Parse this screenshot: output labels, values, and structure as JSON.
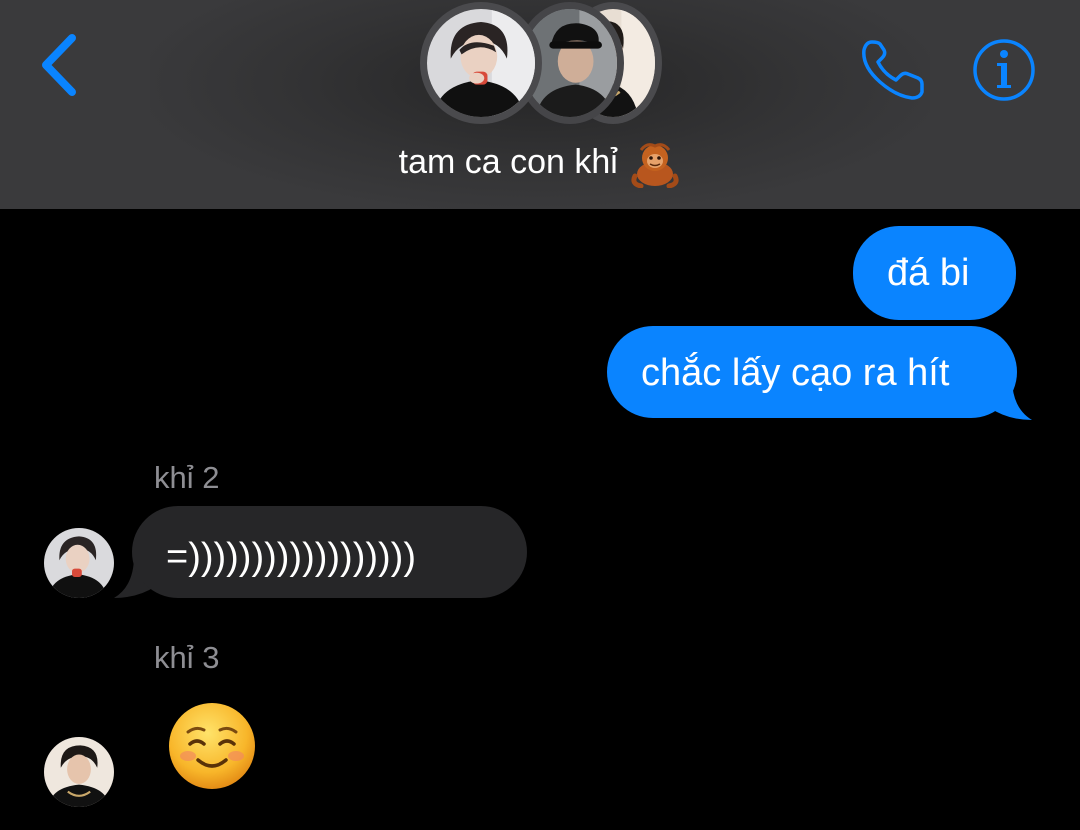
{
  "header": {
    "back_icon": "chevron-left-icon",
    "call_icon": "phone-icon",
    "info_icon": "info-circle-icon",
    "group_title": "tam ca con khỉ",
    "title_emoji": "orangutan-emoji",
    "accent_color": "#0a84ff"
  },
  "messages": {
    "outgoing": [
      {
        "text": "đá bi"
      },
      {
        "text": "chắc lấy cạo ra hít"
      }
    ],
    "incoming": [
      {
        "sender": "khỉ 2",
        "text": "=))))))))))))))))))"
      },
      {
        "sender": "khỉ 3",
        "emoji": "smiling-face-emoji"
      }
    ]
  },
  "colors": {
    "outgoing_bubble": "#0a84ff",
    "incoming_bubble": "#262628",
    "sender_name": "#8e8e93",
    "header_bg": "#3a3a3c"
  }
}
